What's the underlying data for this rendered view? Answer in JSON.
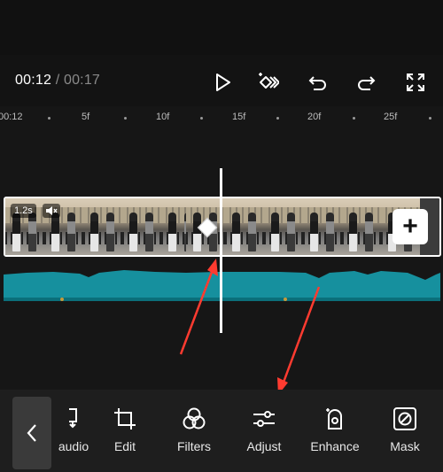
{
  "playback": {
    "current_time": "00:12",
    "separator": " / ",
    "total_time": "00:17",
    "icons": [
      "play-icon",
      "keyframe-icon",
      "undo-icon",
      "redo-icon",
      "fullscreen-icon"
    ]
  },
  "ruler": {
    "labels": [
      "00:12",
      "5f",
      "10f",
      "15f",
      "20f",
      "25f"
    ]
  },
  "clip": {
    "duration_badge": "1.2s",
    "icons": [
      "mute-icon",
      "transition-icon",
      "add-icon"
    ]
  },
  "colors": {
    "audio_waveform": "#16909e",
    "audio_waveform_bottom": "#0b6f7a",
    "keyframe_dot": "#c79a3a",
    "annotation_arrow": "#ff3b30"
  },
  "toolbar": {
    "items": [
      {
        "label": "audio",
        "icon": "extract-audio-icon"
      },
      {
        "label": "Edit",
        "icon": "crop-icon"
      },
      {
        "label": "Filters",
        "icon": "filters-icon"
      },
      {
        "label": "Adjust",
        "icon": "adjust-sliders-icon"
      },
      {
        "label": "Enhance",
        "icon": "enhance-icon"
      },
      {
        "label": "Mask",
        "icon": "mask-icon"
      }
    ],
    "back_icon": "chevron-left-icon"
  }
}
